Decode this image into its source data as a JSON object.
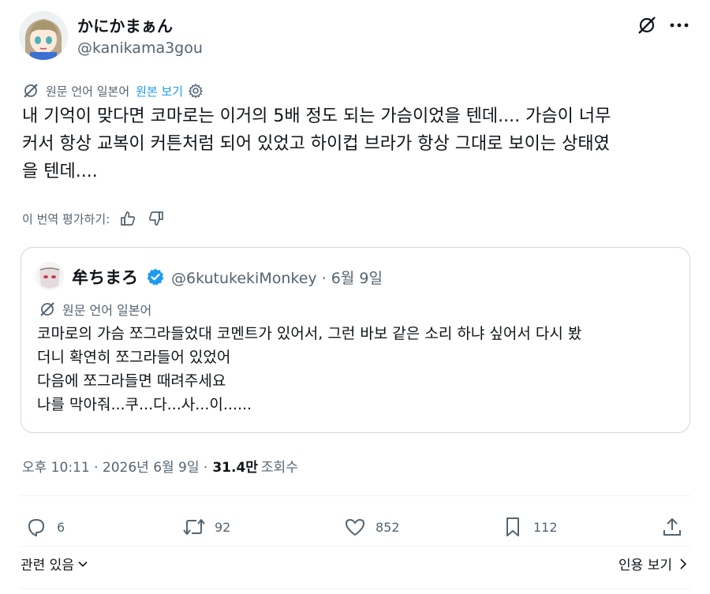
{
  "author": {
    "display_name": "かにかまぁん",
    "handle": "@kanikama3gou"
  },
  "translation_bar": {
    "label": "원문 언어 일본어",
    "show_original": "원본 보기"
  },
  "tweet_text_lines": [
    "내 기억이 맞다면 코마로는 이거의 5배 정도 되는 가슴이었을 텐데.... 가슴이 너무",
    "커서 항상 교복이 커튼처럼 되어 있었고 하이컵 브라가 항상 그대로 보이는 상태였",
    "을 텐데...."
  ],
  "rate_translation": {
    "label": "이 번역 평가하기:"
  },
  "quote": {
    "display_name": "牟ちまろ",
    "handle_and_date": "@6kutukekiMonkey · 6월 9일",
    "translation_label": "원문 언어 일본어",
    "text_lines": [
      "코마로의 가슴 쪼그라들었대 코멘트가 있어서, 그런 바보 같은 소리 하냐 싶어서 다시 봤",
      "더니 확연히 쪼그라들어 있었어",
      "다음에 쪼그라들면 때려주세요",
      "나를 막아줘...쿠...다...사...이......"
    ]
  },
  "meta": {
    "timestamp": "오후 10:11 · 2026년 6월 9일 ·",
    "views_count": "31.4만",
    "views_label": "조회수"
  },
  "actions": {
    "replies": "6",
    "reposts": "92",
    "likes": "852",
    "bookmarks": "112"
  },
  "footer": {
    "related": "관련 있음",
    "view_quotes": "인용 보기"
  },
  "colors": {
    "text": "#0f1419",
    "secondary": "#536471",
    "link": "#1d9bf0",
    "border": "#cfd9de",
    "verified": "#1d9bf0"
  }
}
